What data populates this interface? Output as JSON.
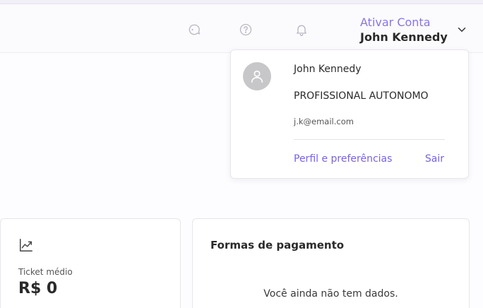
{
  "header": {
    "icons": [
      "chat-support-icon",
      "help-icon",
      "bell-icon"
    ],
    "activate_account": "Ativar Conta",
    "user_name": "John Kennedy"
  },
  "account_menu": {
    "name": "John Kennedy",
    "role": "PROFISSIONAL AUTONOMO",
    "email": "j.k@email.com",
    "profile_link": "Perfil e preferências",
    "logout_link": "Sair"
  },
  "ticket_card": {
    "icon": "trending-up-icon",
    "label": "Ticket médio",
    "value": "R$ 0"
  },
  "payment_card": {
    "title": "Formas de pagamento",
    "empty_message": "Você ainda não tem dados."
  },
  "colors": {
    "accent": "#7a63d8",
    "accent_light": "#8b76e0",
    "avatar_bg": "#c7c7c9"
  }
}
